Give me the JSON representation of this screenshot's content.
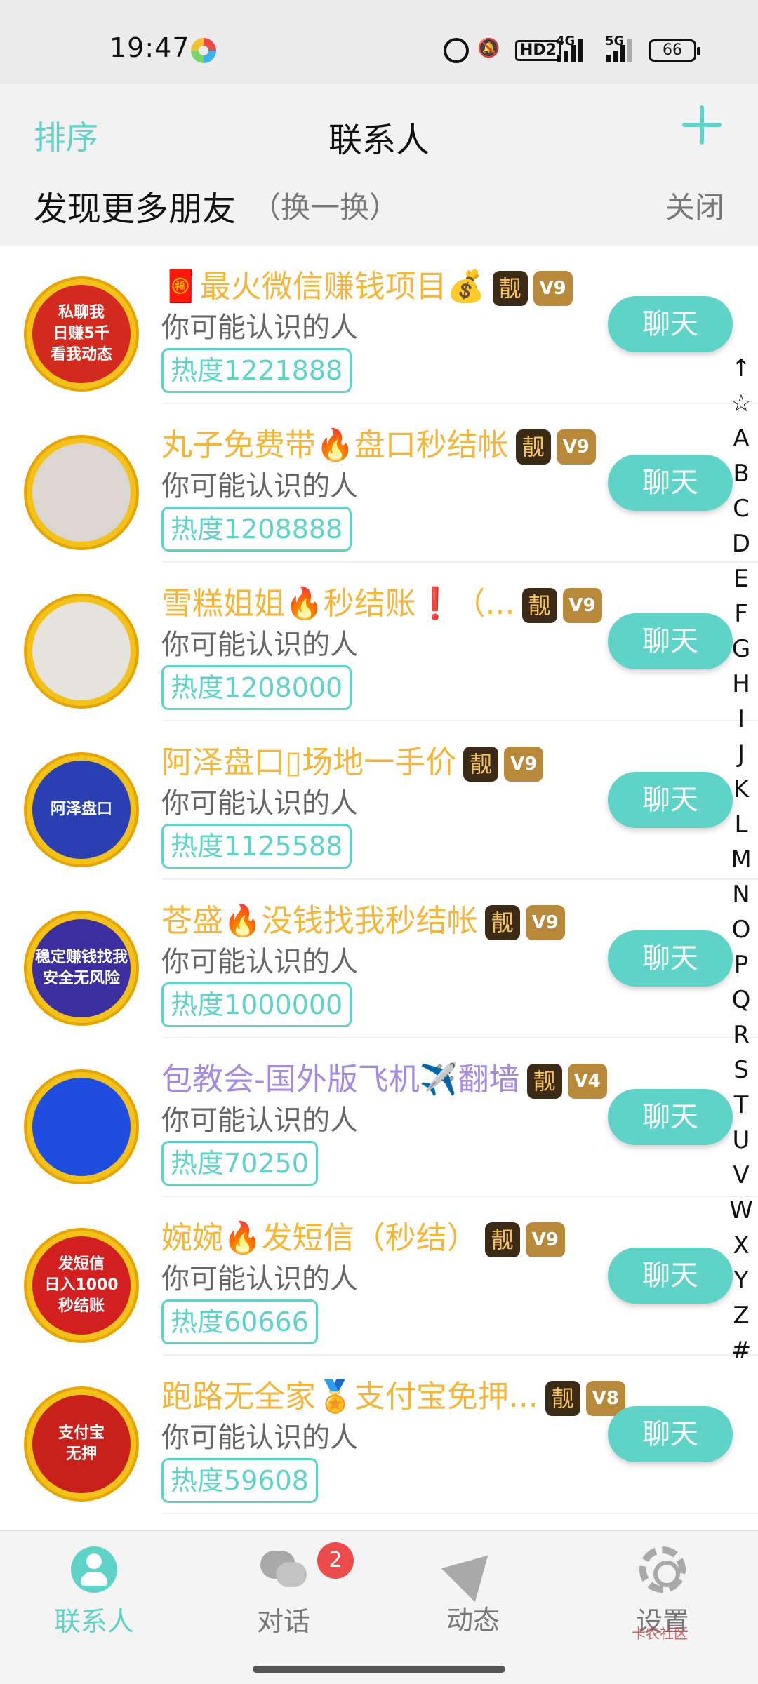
{
  "status_bar": {
    "time": "19:47",
    "hd_label": "HD2",
    "net1": "4G",
    "net2": "5G",
    "battery": "66"
  },
  "header": {
    "sort_label": "排序",
    "title": "联系人",
    "add_icon": "plus-icon",
    "discover_title": "发现更多朋友",
    "discover_refresh": "（换一换）",
    "close_label": "关闭"
  },
  "contacts": [
    {
      "name": "🧧最火微信赚钱项目💰",
      "name_color": "#f4b63a",
      "liang": "靓",
      "level": "V9",
      "subtitle": "你可能认识的人",
      "heat": "热度1221888",
      "button": "聊天",
      "avatar_text": "私聊我\n日赚5千\n看我动态",
      "avatar_bg": "#d22a1f"
    },
    {
      "name": "丸子免费带🔥盘口秒结帐",
      "name_color": "#f4b63a",
      "liang": "靓",
      "level": "V9",
      "subtitle": "你可能认识的人",
      "heat": "热度1208888",
      "button": "聊天",
      "avatar_text": "",
      "avatar_bg": "#dcd6d2"
    },
    {
      "name": "雪糕姐姐🔥秒结账❗（...",
      "name_color": "#f4b63a",
      "liang": "靓",
      "level": "V9",
      "subtitle": "你可能认识的人",
      "heat": "热度1208000",
      "button": "聊天",
      "avatar_text": "",
      "avatar_bg": "#e6e2dc"
    },
    {
      "name": "阿泽盘口▯场地一手价",
      "name_color": "#f4b63a",
      "liang": "靓",
      "level": "V9",
      "subtitle": "你可能认识的人",
      "heat": "热度1125588",
      "button": "聊天",
      "avatar_text": "阿泽盘口",
      "avatar_bg": "#2a3fb2"
    },
    {
      "name": "苍盛🔥没钱找我秒结帐",
      "name_color": "#f4b63a",
      "liang": "靓",
      "level": "V9",
      "subtitle": "你可能认识的人",
      "heat": "热度1000000",
      "button": "聊天",
      "avatar_text": "稳定赚钱找我\n安全无风险",
      "avatar_bg": "#3b2e9e"
    },
    {
      "name": "包教会-国外版飞机✈️翻墙",
      "name_color": "#a58be0",
      "liang": "靓",
      "level": "V4",
      "subtitle": "你可能认识的人",
      "heat": "热度70250",
      "button": "聊天",
      "avatar_text": "",
      "avatar_bg": "#1f4de0"
    },
    {
      "name": "婉婉🔥发短信（秒结）",
      "name_color": "#f4b63a",
      "liang": "靓",
      "level": "V9",
      "subtitle": "你可能认识的人",
      "heat": "热度60666",
      "button": "聊天",
      "avatar_text": "发短信\n日入1000\n秒结账",
      "avatar_bg": "#d21f1f"
    },
    {
      "name": "跑路无全家🏅支付宝免押...",
      "name_color": "#f4b63a",
      "liang": "靓",
      "level": "V8",
      "subtitle": "你可能认识的人",
      "heat": "热度59608",
      "button": "聊天",
      "avatar_text": "支付宝\n无押",
      "avatar_bg": "#c8201a"
    }
  ],
  "index_letters": [
    "↑",
    "☆",
    "A",
    "B",
    "C",
    "D",
    "E",
    "F",
    "G",
    "H",
    "I",
    "J",
    "K",
    "L",
    "M",
    "N",
    "O",
    "P",
    "Q",
    "R",
    "S",
    "T",
    "U",
    "V",
    "W",
    "X",
    "Y",
    "Z",
    "#"
  ],
  "bottom_nav": {
    "tabs": [
      {
        "label": "联系人",
        "icon": "contact-icon",
        "active": true
      },
      {
        "label": "对话",
        "icon": "chat-bubble-icon",
        "badge": "2"
      },
      {
        "label": "动态",
        "icon": "paper-plane-icon"
      },
      {
        "label": "设置",
        "icon": "gear-icon"
      }
    ],
    "watermark": "卡农社区"
  },
  "colors": {
    "accent": "#5fd3c7",
    "gold_name": "#f4b63a",
    "purple_name": "#a58be0"
  }
}
